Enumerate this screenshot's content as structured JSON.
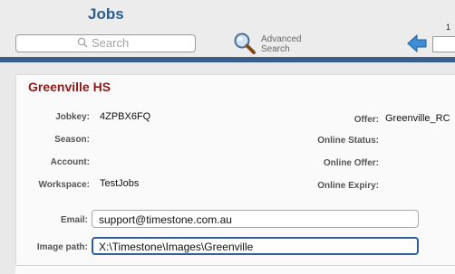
{
  "header": {
    "title": "Jobs",
    "search_placeholder": "Search",
    "advanced_search_line1": "Advanced",
    "advanced_search_line2": "Search",
    "page_number": "1"
  },
  "record": {
    "title": "Greenville HS",
    "left_fields": [
      {
        "label": "Jobkey:",
        "value": "4ZPBX6FQ"
      },
      {
        "label": "Season:",
        "value": ""
      },
      {
        "label": "Account:",
        "value": ""
      },
      {
        "label": "Workspace:",
        "value": "TestJobs"
      }
    ],
    "right_fields": [
      {
        "label": "Offer:",
        "value": "Greenville_RC"
      },
      {
        "label": "Online Status:",
        "value": ""
      },
      {
        "label": "Online Offer:",
        "value": ""
      },
      {
        "label": "Online Expiry:",
        "value": ""
      }
    ],
    "email": {
      "label": "Email:",
      "value": "support@timestone.com.au"
    },
    "image_path": {
      "label": "Image path:",
      "value": "X:\\Timestone\\Images\\Greenville"
    }
  },
  "colors": {
    "title_blue": "#2c5d8f",
    "record_title_red": "#8b1a1a",
    "divider_blue": "#3a5f8c"
  },
  "icons": {
    "search": "magnifier-icon",
    "advanced_search": "magnifying-glass-icon",
    "back": "back-arrow-icon"
  }
}
